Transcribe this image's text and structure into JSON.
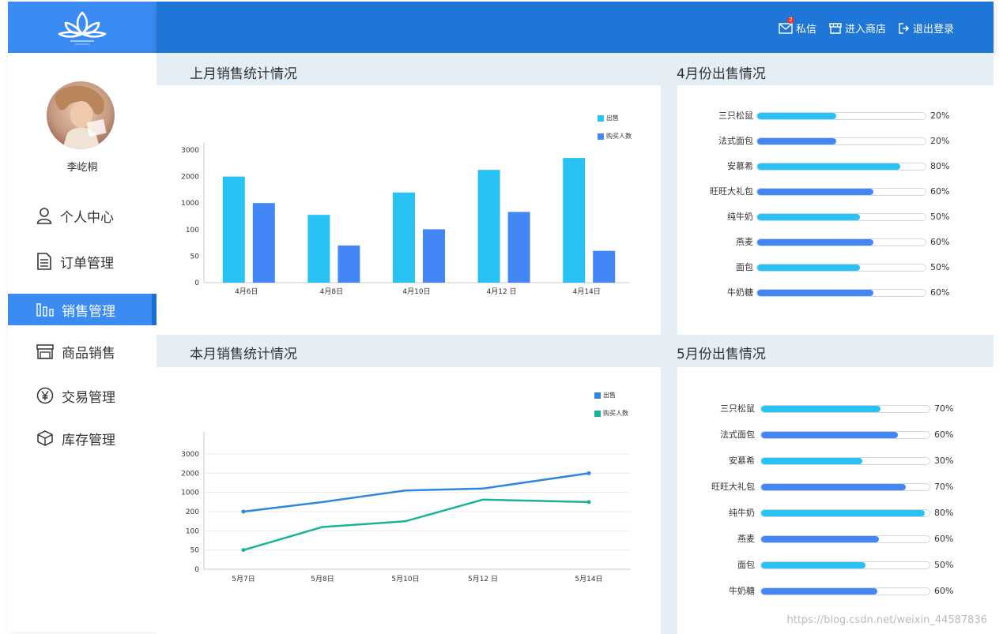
{
  "header": {
    "actions": [
      {
        "label": "私信",
        "icon": "mail-icon",
        "badge": "2"
      },
      {
        "label": "进入商店",
        "icon": "store-icon"
      },
      {
        "label": "退出登录",
        "icon": "logout-icon"
      }
    ]
  },
  "sidebar": {
    "user_name": "李屹桐",
    "items": [
      {
        "label": "个人中心",
        "icon": "user-icon"
      },
      {
        "label": "订单管理",
        "icon": "document-icon"
      },
      {
        "label": "销售管理",
        "icon": "bar-chart-icon",
        "active": true
      },
      {
        "label": "商品销售",
        "icon": "shop-icon"
      },
      {
        "label": "交易管理",
        "icon": "yen-icon"
      },
      {
        "label": "库存管理",
        "icon": "box-icon"
      }
    ]
  },
  "panels": {
    "last_month_title": "上月销售统计情况",
    "april_title": "4月份出售情况",
    "this_month_title": "本月销售统计情况",
    "may_title": "5月份出售情况"
  },
  "colors": {
    "accent": "#3b8cf2",
    "header": "#1e77d6",
    "cyan": "#29c2f4",
    "blue": "#4287f5",
    "teal": "#1ab39a",
    "line_blue": "#2f86e0"
  },
  "april_progress": [
    {
      "name": "三只松鼠",
      "pct": "20%",
      "value": 0.47
    },
    {
      "name": "法式面包",
      "pct": "20%",
      "value": 0.47
    },
    {
      "name": "安慕希",
      "pct": "80%",
      "value": 0.85
    },
    {
      "name": "旺旺大礼包",
      "pct": "60%",
      "value": 0.69
    },
    {
      "name": "纯牛奶",
      "pct": "50%",
      "value": 0.61
    },
    {
      "name": "燕麦",
      "pct": "60%",
      "value": 0.69
    },
    {
      "name": "面包",
      "pct": "50%",
      "value": 0.61
    },
    {
      "name": "牛奶糖",
      "pct": "60%",
      "value": 0.69
    }
  ],
  "may_progress": [
    {
      "name": "三只松鼠",
      "pct": "70%",
      "value": 0.71
    },
    {
      "name": "法式面包",
      "pct": "60%",
      "value": 0.81
    },
    {
      "name": "安慕希",
      "pct": "30%",
      "value": 0.6
    },
    {
      "name": "旺旺大礼包",
      "pct": "70%",
      "value": 0.86
    },
    {
      "name": "纯牛奶",
      "pct": "80%",
      "value": 0.97
    },
    {
      "name": "燕麦",
      "pct": "60%",
      "value": 0.7
    },
    {
      "name": "面包",
      "pct": "50%",
      "value": 0.62
    },
    {
      "name": "牛奶糖",
      "pct": "60%",
      "value": 0.69
    }
  ],
  "chart_data": [
    {
      "type": "bar",
      "title": "",
      "categories": [
        "4月6日",
        "4月8日",
        "4月10日",
        "4月12 日",
        "4月14日"
      ],
      "y_ticks": [
        "0",
        "50",
        "100",
        "1000",
        "2000",
        "3000"
      ],
      "legend_position": "top-right",
      "series": [
        {
          "name": "出售",
          "color": "#29c2f4",
          "values": [
            2000,
            600,
            1400,
            2250,
            2700
          ]
        },
        {
          "name": "购买人数",
          "color": "#4287f5",
          "values": [
            1000,
            70,
            110,
            700,
            60
          ]
        }
      ]
    },
    {
      "type": "line",
      "title": "",
      "categories": [
        "5月7日",
        "5月8日",
        "5月10日",
        "5月12 日",
        "5月14日"
      ],
      "y_ticks": [
        "0",
        "50",
        "100",
        "200",
        "1000",
        "2000",
        "3000"
      ],
      "legend_position": "top-right",
      "series": [
        {
          "name": "出售",
          "color": "#2f86e0",
          "values": [
            200,
            600,
            1100,
            1200,
            2000
          ]
        },
        {
          "name": "购买人数",
          "color": "#1ab39a",
          "values": [
            50,
            120,
            150,
            700,
            600
          ]
        }
      ]
    }
  ],
  "watermark": "https://blog.csdn.net/weixin_44587836"
}
